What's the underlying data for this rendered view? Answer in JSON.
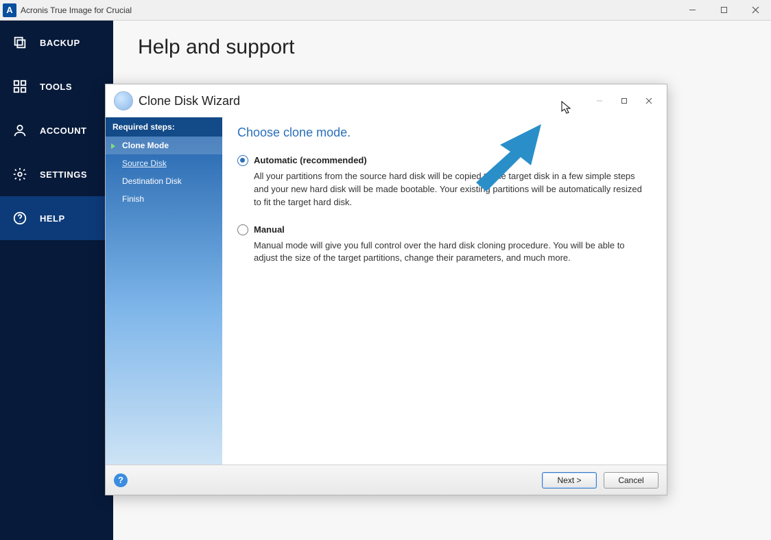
{
  "window": {
    "title": "Acronis True Image for Crucial"
  },
  "sidebar": {
    "items": [
      {
        "label": "BACKUP"
      },
      {
        "label": "TOOLS"
      },
      {
        "label": "ACCOUNT"
      },
      {
        "label": "SETTINGS"
      },
      {
        "label": "HELP"
      }
    ]
  },
  "page": {
    "title": "Help and support"
  },
  "dialog": {
    "title": "Clone Disk Wizard",
    "steps_header": "Required steps:",
    "steps": [
      {
        "label": "Clone Mode",
        "state": "current"
      },
      {
        "label": "Source Disk",
        "state": "link"
      },
      {
        "label": "Destination Disk",
        "state": "pending"
      },
      {
        "label": "Finish",
        "state": "pending"
      }
    ],
    "heading": "Choose clone mode.",
    "options": [
      {
        "title": "Automatic (recommended)",
        "desc": "All your partitions from the source hard disk will be copied to the target disk in a few simple steps and your new hard disk will be made bootable. Your existing partitions will be automatically resized to fit the target hard disk.",
        "checked": true
      },
      {
        "title": "Manual",
        "desc": "Manual mode will give you full control over the hard disk cloning procedure. You will be able to adjust the size of the target partitions, change their parameters, and much more.",
        "checked": false
      }
    ],
    "buttons": {
      "next": "Next >",
      "cancel": "Cancel"
    }
  }
}
